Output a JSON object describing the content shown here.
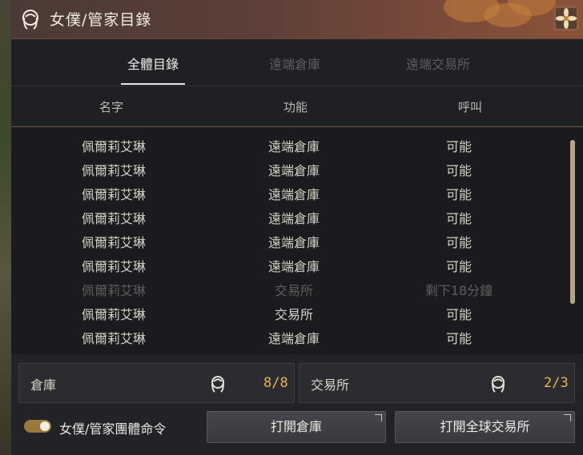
{
  "window": {
    "title": "女僕/管家目錄",
    "icon": "maid-icon",
    "corner_icon": "flower-emblem-icon"
  },
  "tabs": [
    {
      "label": "全體目錄",
      "active": true
    },
    {
      "label": "遠端倉庫",
      "active": false
    },
    {
      "label": "遠端交易所",
      "active": false
    }
  ],
  "columns": [
    "名字",
    "功能",
    "呼叫"
  ],
  "rows": [
    {
      "name": "佩爾莉艾琳",
      "function": "遠端倉庫",
      "call": "可能",
      "disabled": false
    },
    {
      "name": "佩爾莉艾琳",
      "function": "遠端倉庫",
      "call": "可能",
      "disabled": false
    },
    {
      "name": "佩爾莉艾琳",
      "function": "遠端倉庫",
      "call": "可能",
      "disabled": false
    },
    {
      "name": "佩爾莉艾琳",
      "function": "遠端倉庫",
      "call": "可能",
      "disabled": false
    },
    {
      "name": "佩爾莉艾琳",
      "function": "遠端倉庫",
      "call": "可能",
      "disabled": false
    },
    {
      "name": "佩爾莉艾琳",
      "function": "遠端倉庫",
      "call": "可能",
      "disabled": false
    },
    {
      "name": "佩爾莉艾琳",
      "function": "交易所",
      "call": "剩下18分鐘",
      "disabled": true
    },
    {
      "name": "佩爾莉艾琳",
      "function": "交易所",
      "call": "可能",
      "disabled": false
    },
    {
      "name": "佩爾莉艾琳",
      "function": "遠端倉庫",
      "call": "可能",
      "disabled": false
    }
  ],
  "stats": {
    "storage": {
      "label": "倉庫",
      "value": "8/8",
      "icon": "maid-icon"
    },
    "market": {
      "label": "交易所",
      "value": "2/3",
      "icon": "maid-icon"
    }
  },
  "toggle": {
    "label": "女僕/管家團體命令",
    "on": true
  },
  "buttons": {
    "open_storage": "打開倉庫",
    "open_market": "打開全球交易所"
  },
  "colors": {
    "accent": "#e4b35a",
    "text": "#d6d2c6",
    "disabled_text": "#5f5e5b",
    "title_bar": "#5e4038"
  }
}
